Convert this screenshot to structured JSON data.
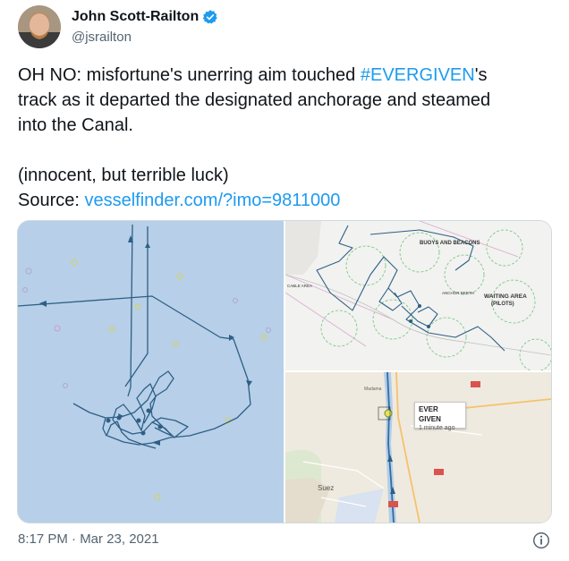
{
  "author": {
    "name": "John Scott-Railton",
    "handle": "@jsrailton"
  },
  "tweet": {
    "line1_pre": "OH NO: misfortune's unerring aim touched ",
    "hashtag": "#EVERGIVEN",
    "line1_post": "'s",
    "line2": "track as it departed the designated anchorage and steamed",
    "line3": "into the Canal.",
    "line4": "(innocent, but terrible luck)",
    "source_label": "Source: ",
    "source_link": "vesselfinder.com/?imo=9811000"
  },
  "media": {
    "top_right_labels": {
      "buoys": "BUOYS AND BEACONS",
      "waiting": "WAITING AREA",
      "pilots": "(PILOTS)",
      "cable": "CABLE AREA",
      "anchor": "ANCHOR BERTH"
    },
    "bottom_right": {
      "vessel_name": "EVER GIVEN",
      "vessel_time": "1 minute ago",
      "town_suez": "Suez",
      "town_madama": "Madama"
    }
  },
  "footer": {
    "timestamp": "8:17 PM · Mar 23, 2021"
  },
  "colors": {
    "link": "#1d9bf0",
    "verified": "#1d9bf0",
    "track": "#2d5f86"
  },
  "icons": [
    "verified-badge-icon",
    "info-icon"
  ]
}
